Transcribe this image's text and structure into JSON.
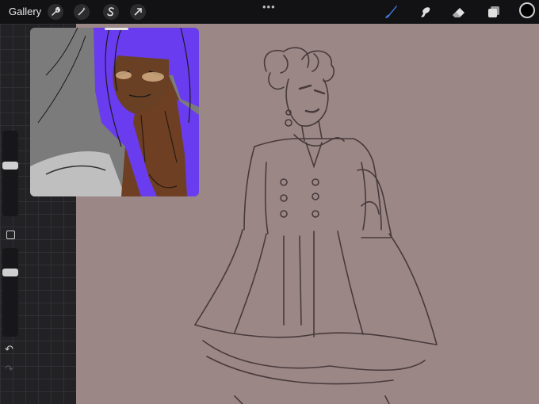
{
  "toolbar": {
    "gallery_label": "Gallery",
    "left_tools": [
      {
        "name": "actions",
        "icon": "wrench-icon",
        "glyph": "🔧"
      },
      {
        "name": "adjustments",
        "icon": "magic-wand-icon",
        "glyph": "✦"
      },
      {
        "name": "selection",
        "icon": "selection-s-icon",
        "glyph": "S"
      },
      {
        "name": "transform",
        "icon": "transform-arrow-icon",
        "glyph": "➚"
      }
    ],
    "more_label": "•••",
    "right_tools": [
      {
        "name": "brush",
        "icon": "brush-icon",
        "active": true
      },
      {
        "name": "smudge",
        "icon": "smudge-icon",
        "active": false
      },
      {
        "name": "eraser",
        "icon": "eraser-icon",
        "active": false
      },
      {
        "name": "layers",
        "icon": "layers-icon",
        "active": false
      }
    ],
    "active_color": "#000000"
  },
  "sidebar": {
    "brush_size_level": 0.6,
    "opacity_level": 0.75,
    "undo_glyph": "↶",
    "redo_glyph": "↷"
  },
  "colors": {
    "canvas": "#9c8787",
    "accent": "#3c7bdc",
    "hair_purple": "#6a3cf0",
    "skin": "#6e3f22"
  }
}
